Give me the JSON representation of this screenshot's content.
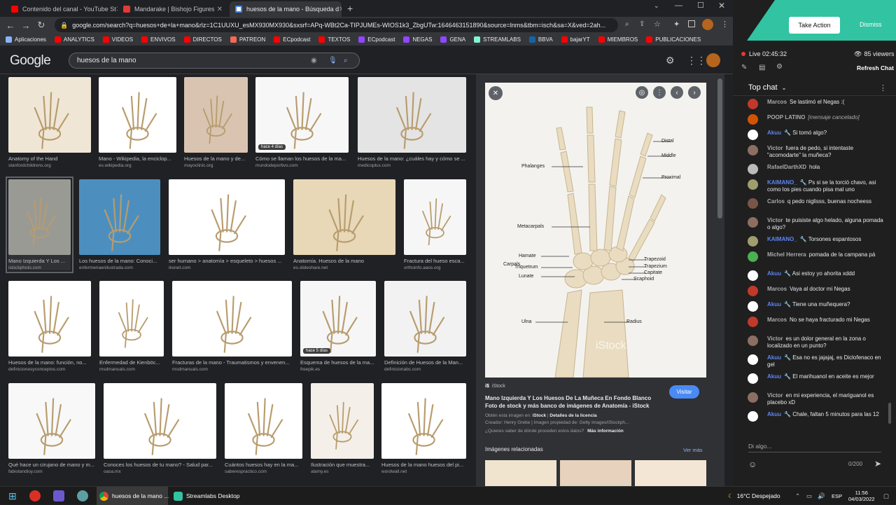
{
  "browser": {
    "tabs": [
      {
        "title": "Contenido del canal - YouTube St",
        "color": "#ff0000"
      },
      {
        "title": "Mandarake | Bishojo Figures",
        "color": "#e53935"
      },
      {
        "title": "huesos de la mano - Búsqueda d",
        "color": "#4285f4"
      }
    ],
    "url": "google.com/search?q=huesos+de+la+mano&rlz=1C1UUXU_esMX930MX930&sxsrf=APq-WBt2Ca-TIPJUMEs-WIOS1k3_ZbgUTw:1646463151890&source=lnms&tbm=isch&sa=X&ved=2ah...",
    "bookmarks": [
      {
        "label": "Aplicaciones",
        "color": "#8ab4f8"
      },
      {
        "label": "ANALYTICS",
        "color": "#ff0000"
      },
      {
        "label": "VIDEOS",
        "color": "#ff0000"
      },
      {
        "label": "ENVIVOS",
        "color": "#ff0000"
      },
      {
        "label": "DIRECTOS",
        "color": "#ff0000"
      },
      {
        "label": "PATREON",
        "color": "#f96854"
      },
      {
        "label": "ECpodcast",
        "color": "#ff0000"
      },
      {
        "label": "TEXTOS",
        "color": "#ff0000"
      },
      {
        "label": "ECpodcast",
        "color": "#9146ff"
      },
      {
        "label": "NEGAS",
        "color": "#9146ff"
      },
      {
        "label": "GENA",
        "color": "#9146ff"
      },
      {
        "label": "STREAMLABS",
        "color": "#80f5d2"
      },
      {
        "label": "BBVA",
        "color": "#1464a5"
      },
      {
        "label": "bajarYT",
        "color": "#ff0000"
      },
      {
        "label": "MIEMBROS",
        "color": "#ff0000"
      },
      {
        "label": "PUBLICACIONES",
        "color": "#ff0000"
      }
    ]
  },
  "google": {
    "logo": "Google",
    "query": "huesos de la mano"
  },
  "results": [
    {
      "caption": "Anatomy of the Hand",
      "source": "stanfordchildrens.org",
      "bg": "#f0e6d6"
    },
    {
      "caption": "Mano - Wikipedia, la enciclop...",
      "source": "es.wikipedia.org",
      "bg": "#ffffff"
    },
    {
      "caption": "Huesos de la mano y de...",
      "source": "mayoclinic.org",
      "bg": "#d8c4b0"
    },
    {
      "caption": "Cómo se llaman los huesos de la ma...",
      "source": "mundodeportivo.com",
      "bg": "#f7f7f7",
      "badge": "hace 4 días"
    },
    {
      "caption": "Huesos de la mano: ¿cuáles hay y cómo se ...",
      "source": "medicoplus.com",
      "bg": "#e4e4e4"
    },
    {
      "caption": "Mano Izquierda Y Los ...",
      "source": "istockphoto.com",
      "bg": "#9a9a94"
    },
    {
      "caption": "Los huesos de la mano: Conoci...",
      "source": "enfermeriaenilustrada.com",
      "bg": "#4c8fbf"
    },
    {
      "caption": "ser humano > anatomía > esqueleto > huesos ...",
      "source": "ikonet.com",
      "bg": "#ffffff"
    },
    {
      "caption": "Anatomía. Huesos de la mano",
      "source": "es.slideshare.net",
      "bg": "#e8d8b8"
    },
    {
      "caption": "Fractura del hueso esca...",
      "source": "orthoinfo.aaos.org",
      "bg": "#f6f6f6"
    },
    {
      "caption": "Huesos de la mano: función, no...",
      "source": "definicionesyconceptos.com",
      "bg": "#ffffff"
    },
    {
      "caption": "Enfermedad de Kienböc...",
      "source": "msdmanuals.com",
      "bg": "#ffffff"
    },
    {
      "caption": "Fracturas de la mano - Traumatismos y envenen...",
      "source": "msdmanuals.com",
      "bg": "#ffffff"
    },
    {
      "caption": "Esquema de huesos de la ma...",
      "source": "freepik.es",
      "bg": "#f6f6f6",
      "badge": "hace 5 días"
    },
    {
      "caption": "Definición de Huesos de la Man...",
      "source": "definicionabc.com",
      "bg": "#f2f2f2"
    },
    {
      "caption": "Qué hace un cirujano de mano y m...",
      "source": "fabiotandioy.com",
      "bg": "#f8f8f8"
    },
    {
      "caption": "Conoces los huesos de tu mano? - Salud par...",
      "source": "oasa.mx",
      "bg": "#ffffff"
    },
    {
      "caption": "Cuántos huesos hay en la ma...",
      "source": "saberespractico.com",
      "bg": "#ffffff"
    },
    {
      "caption": "Ilustración que muestra...",
      "source": "alamy.es",
      "bg": "#f4efe8"
    },
    {
      "caption": "Huesos de la mano huesos del pi...",
      "source": "wordwall.net",
      "bg": "#ffffff"
    }
  ],
  "preview": {
    "source_name": "iStock",
    "title": "Mano Izquierda Y Los Huesos De La Muñeca En Fondo Blanco Foto de stock y más banco de imágenes de Anatomía - iStock",
    "visit_label": "Visitar",
    "obtain_prefix": "Obtén esta imagen en:",
    "obtain_site": "iStock",
    "license_label": "Detalles de la licencia",
    "creator_line": "Creador: Henry Grebe | Imagen propiedad de: Getty Images/iStockph...",
    "question": "¿Quieres saber de dónde proceden estos datos?",
    "more_info": "Más información",
    "related_label": "Imágenes relacionadas",
    "see_more": "Ver más",
    "bone_labels": [
      "Distal",
      "Middle",
      "Proximal",
      "Phalanges",
      "Metacarpals",
      "Hamate",
      "Triquetrum",
      "Lunate",
      "Carpals",
      "Trapezoid",
      "Trapezium",
      "Capitate",
      "Scaphoid",
      "Ulna",
      "Radius"
    ],
    "watermark": "iStock"
  },
  "chat": {
    "take_action": "Take Action",
    "dismiss": "Dismiss",
    "live": "Live 02:45:32",
    "viewers": "85 viewers",
    "refresh": "Refresh Chat",
    "mode": "Top chat",
    "placeholder": "Di algo...",
    "counter": "0/200",
    "messages": [
      {
        "name": "Marcos",
        "text": "Se lastimó el Negas :(",
        "color": "#c0392b",
        "blue": false
      },
      {
        "name": "POOP LATINO",
        "text": "[mensaje cancelado]",
        "color": "#d35400",
        "blue": false
      },
      {
        "name": "Akuu",
        "text": "Si tomó algo?",
        "color": "#ffffff",
        "blue": true
      },
      {
        "name": "Victor",
        "text": "fuera de pedo, si intentaste \"acomodarte\" la muñeca?",
        "color": "#8d6e63",
        "blue": false
      },
      {
        "name": "RafaelDarthXD",
        "text": "hola",
        "color": "#bbbbbb",
        "blue": false
      },
      {
        "name": "KAIMANO_",
        "text": "Ps si se la torció chavo, asi como los pies cuando pisa mal uno",
        "color": "#9e9e6e",
        "blue": true
      },
      {
        "name": "Carlos",
        "text": "q pedo niglisss, buenas nocheess",
        "color": "#795548",
        "blue": false
      },
      {
        "name": "Victor",
        "text": "te puisiste algo helado, alguna pomada o algo?",
        "color": "#8d6e63",
        "blue": false
      },
      {
        "name": "KAIMANO_",
        "text": "Torsones espantosos",
        "color": "#9e9e6e",
        "blue": true
      },
      {
        "name": "Michel Herrera",
        "text": "pomada de la campana pá",
        "color": "#4caf50",
        "blue": false
      },
      {
        "name": "Akuu",
        "text": "Asi estoy yo ahorita xddd",
        "color": "#ffffff",
        "blue": true
      },
      {
        "name": "Marcos",
        "text": "Vaya al doctor mi Negas",
        "color": "#c0392b",
        "blue": false
      },
      {
        "name": "Akuu",
        "text": "Tiene una muñequera?",
        "color": "#ffffff",
        "blue": true
      },
      {
        "name": "Marcos",
        "text": "No se haya fracturado mi Negas",
        "color": "#c0392b",
        "blue": false
      },
      {
        "name": "Victor",
        "text": "es un dolor general en la zona o localizado en un punto?",
        "color": "#8d6e63",
        "blue": false
      },
      {
        "name": "Akuu",
        "text": "Esa no es jajajaj, es Diclofenaco en gel",
        "color": "#ffffff",
        "blue": true
      },
      {
        "name": "Akuu",
        "text": "El marihuanol en aceite es mejor",
        "color": "#ffffff",
        "blue": true
      },
      {
        "name": "Victor",
        "text": "en mi experiencia, el mariguanol es placebo xD",
        "color": "#8d6e63",
        "blue": false
      },
      {
        "name": "Akuu",
        "text": "Chale, faltan 5 minutos para las 12",
        "color": "#ffffff",
        "blue": true
      }
    ]
  },
  "taskbar": {
    "apps": [
      "huesos de la mano ...",
      "Streamlabs Desktop"
    ],
    "weather": "16°C Despejado",
    "lang": "ESP",
    "time": "11:56",
    "date": "04/03/2022"
  }
}
